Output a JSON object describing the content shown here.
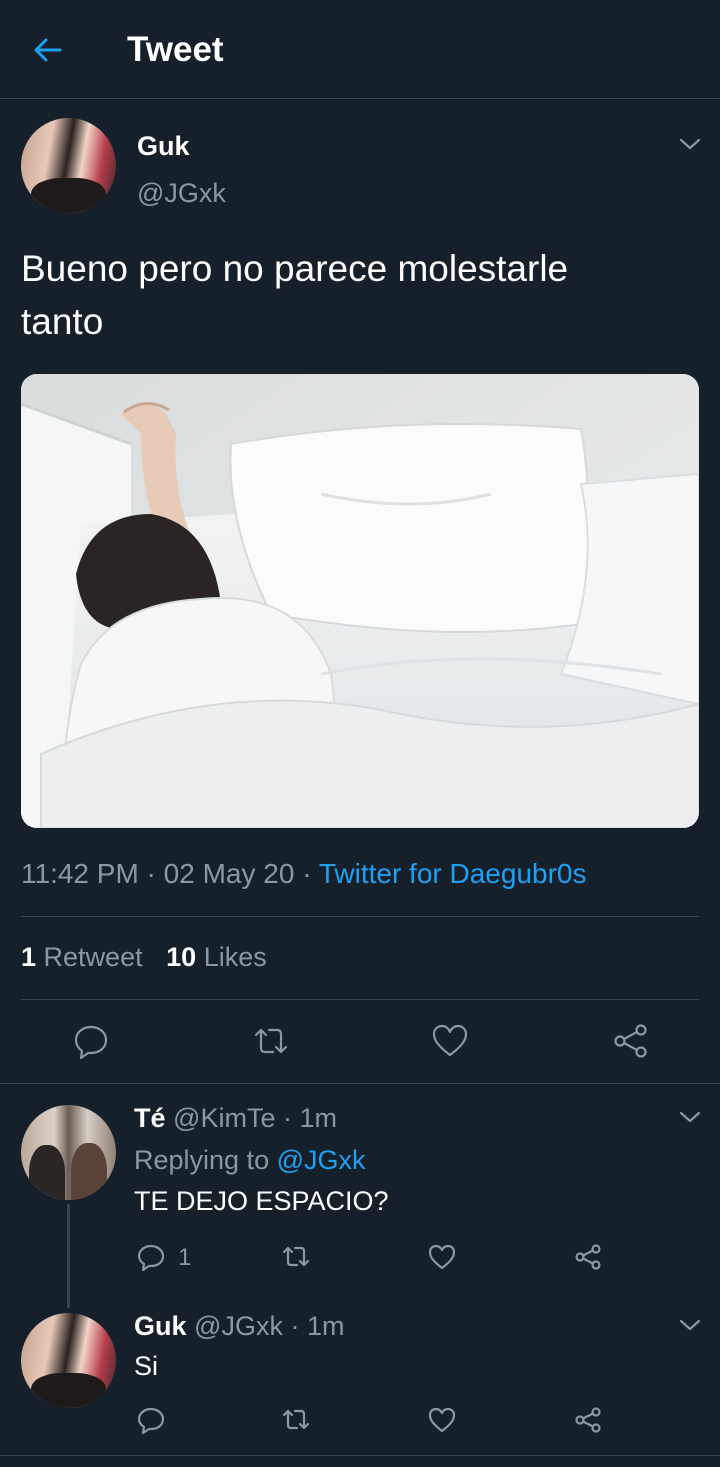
{
  "header": {
    "title": "Tweet"
  },
  "tweet": {
    "name": "Guk",
    "handle": "@JGxk",
    "text_line1": "Bueno pero no parece molestarle",
    "text_line2": "tanto",
    "time": "11:42 PM",
    "sep1": " · ",
    "date": "02 May 20",
    "sep2": " · ",
    "source": "Twitter for Daegubr0s",
    "retweets_count": "1",
    "retweets_label": "Retweet",
    "likes_count": "10",
    "likes_label": "Likes"
  },
  "replies": [
    {
      "name": "Té",
      "handle": "@KimTe",
      "time": "· 1m",
      "replying_prefix": "Replying to",
      "replying_to": "@JGxk",
      "text": "TE DEJO ESPACIO?",
      "reply_count": "1"
    },
    {
      "name": "Guk",
      "handle": "@JGxk",
      "time": "· 1m",
      "text": "Si"
    }
  ],
  "colors": {
    "background": "#15202b",
    "accent": "#1da1f2",
    "muted": "#8899a6",
    "divider": "#38444d"
  }
}
